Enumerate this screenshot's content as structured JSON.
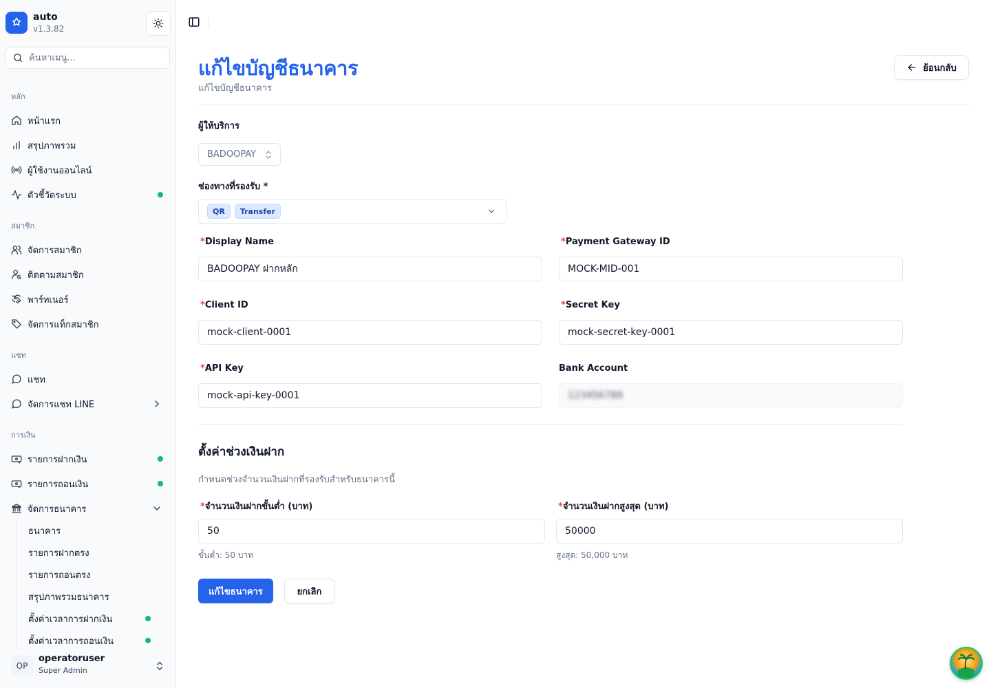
{
  "app": {
    "name": "auto",
    "version": "v1.3.82"
  },
  "search": {
    "placeholder": "ค้นหาเมนู..."
  },
  "sidebar": {
    "groups": [
      {
        "label": "หลัก",
        "items": [
          {
            "label": "หน้าแรก",
            "icon": "home-icon"
          },
          {
            "label": "สรุปภาพรวม",
            "icon": "bar-chart-icon"
          },
          {
            "label": "ผู้ใช้งานออนไลน์",
            "icon": "radio-icon"
          },
          {
            "label": "ตัวชี้วัดระบบ",
            "icon": "activity-icon",
            "status_dot": true
          }
        ]
      },
      {
        "label": "สมาชิก",
        "items": [
          {
            "label": "จัดการสมาชิก",
            "icon": "users-icon"
          },
          {
            "label": "ติดตามสมาชิก",
            "icon": "user-search-icon"
          },
          {
            "label": "พาร์ทเนอร์",
            "icon": "handshake-icon"
          },
          {
            "label": "จัดการแท็กสมาชิก",
            "icon": "tag-icon"
          }
        ]
      },
      {
        "label": "แชท",
        "items": [
          {
            "label": "แชท",
            "icon": "message-circle-icon"
          },
          {
            "label": "จัดการแชท LINE",
            "icon": "message-circle-icon",
            "expandable": true
          }
        ]
      },
      {
        "label": "การเงิน",
        "items": [
          {
            "label": "รายการฝากเงิน",
            "icon": "deposit-icon",
            "status_dot": true
          },
          {
            "label": "รายการถอนเงิน",
            "icon": "withdraw-icon",
            "status_dot": true
          },
          {
            "label": "จัดการธนาคาร",
            "icon": "bank-icon",
            "expanded": true
          }
        ]
      }
    ],
    "bank_subitems": [
      {
        "label": "ธนาคาร"
      },
      {
        "label": "รายการฝากตรง"
      },
      {
        "label": "รายการถอนตรง"
      },
      {
        "label": "สรุปภาพรวมธนาคาร"
      },
      {
        "label": "ตั้งค่าเวลาการฝากเงิน",
        "status_dot": true
      },
      {
        "label": "ตั้งค่าเวลาการถอนเงิน",
        "status_dot": true
      }
    ],
    "status_dot_color": "#10b981"
  },
  "user": {
    "initials": "OP",
    "name": "operatoruser",
    "role": "Super Admin"
  },
  "page": {
    "title": "แก้ไขบัญชีธนาคาร",
    "subtitle": "แก้ไขบัญชีธนาคาร",
    "back_label": "ย้อนกลับ",
    "accent_color": "#2563eb"
  },
  "form": {
    "provider": {
      "label": "ผู้ให้บริการ",
      "value": "BADOOPAY"
    },
    "channels": {
      "label": "ช่องทางที่รองรับ *",
      "tags": [
        "QR",
        "Transfer"
      ]
    },
    "display_name": {
      "label": "Display Name",
      "value": "BADOOPAY ฝากหลัก"
    },
    "payment_gateway_id": {
      "label": "Payment Gateway ID",
      "value": "MOCK-MID-001"
    },
    "client_id": {
      "label": "Client ID",
      "value": "mock-client-0001"
    },
    "secret_key": {
      "label": "Secret Key",
      "value": "mock-secret-key-0001"
    },
    "api_key": {
      "label": "API Key",
      "value": "mock-api-key-0001"
    },
    "bank_account": {
      "label": "Bank Account",
      "value": "123456789"
    },
    "deposit_range": {
      "title": "ตั้งค่าช่วงเงินฝาก",
      "description": "กำหนดช่วงจำนวนเงินฝากที่รองรับสำหรับธนาคารนี้",
      "min": {
        "label": "จำนวนเงินฝากขั้นต่ำ (บาท)",
        "value": "50",
        "hint": "ขั้นต่ำ: 50 บาท"
      },
      "max": {
        "label": "จำนวนเงินฝากสูงสุด (บาท)",
        "value": "50000",
        "hint": "สูงสุด: 50,000 บาท"
      }
    },
    "submit_label": "แก้ไขธนาคาร",
    "cancel_label": "ยกเลิก"
  }
}
